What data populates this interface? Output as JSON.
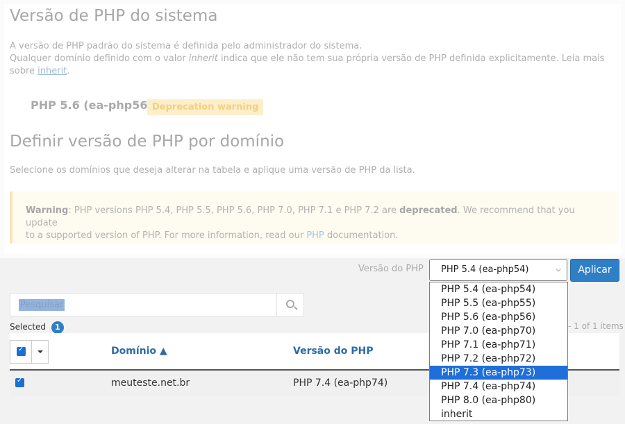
{
  "system_section": {
    "title": "Versão de PHP do sistema",
    "desc_line1": "A versão de PHP padrão do sistema é definida pelo administrador do sistema.",
    "desc_line2_pre": "Qualquer domínio definido com o valor ",
    "desc_line2_italic": "inherit",
    "desc_line2_post": " indica que ele não tem sua própria versão de PHP definida explicitamente. Leia mais",
    "desc_line3_pre": "sobre ",
    "inherit_link": "inherit",
    "desc_line3_post": ".",
    "current_version": "PHP 5.6 (ea-php56)",
    "deprecation_badge": "Deprecation warning"
  },
  "domain_section": {
    "title": "Definir versão de PHP por domínio",
    "description": "Selecione os domínios que deseja alterar na tabela e aplique uma versão de PHP da lista."
  },
  "warning": {
    "label": "Warning",
    "text_1": ": PHP versions PHP 5.4, PHP 5.5, PHP 5.6, PHP 7.0, PHP 7.1 e PHP 7.2 are ",
    "deprecated": "deprecated",
    "text_2": ". We recommend that you update",
    "text_3": "to a supported version of PHP. For more information, read our ",
    "php_link": "PHP",
    "text_4": " documentation."
  },
  "toolbar": {
    "version_label": "Versão do PHP",
    "selected_value": "PHP 5.4 (ea-php54)",
    "apply_label": "Aplicar"
  },
  "dropdown": {
    "options": [
      "PHP 5.4 (ea-php54)",
      "PHP 5.5 (ea-php55)",
      "PHP 5.6 (ea-php56)",
      "PHP 7.0 (ea-php70)",
      "PHP 7.1 (ea-php71)",
      "PHP 7.2 (ea-php72)",
      "PHP 7.3 (ea-php73)",
      "PHP 7.4 (ea-php74)",
      "PHP 8.0 (ea-php80)",
      "inherit"
    ],
    "highlighted": "PHP 7.3 (ea-php73)"
  },
  "search": {
    "placeholder": "Pesquisar"
  },
  "selection": {
    "label": "Selected",
    "count": "1"
  },
  "pager": {
    "text": "- 1 of 1 items"
  },
  "table": {
    "headers": {
      "domain": "Domínio ▲",
      "version": "Versão do PHP"
    },
    "rows": [
      {
        "domain": "meuteste.net.br",
        "version": "PHP 7.4 (ea-php74)"
      }
    ]
  },
  "colors": {
    "primary": "#2f7fc7",
    "highlight": "#1e6fd9",
    "warning_bg": "#fefbf0"
  }
}
